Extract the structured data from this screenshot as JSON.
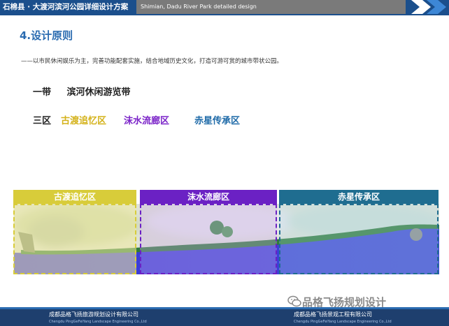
{
  "header": {
    "title_cn": "石棉县 · 大渡河滨河公园详细设计方案",
    "title_en": "Shimian, Dadu River Park detailed design"
  },
  "section": {
    "title": "4.设计原则",
    "intro": "——以市民休闲娱乐为主，完善功能配套实施，结合地域历史文化，打造可游可赏的城市带状公园。"
  },
  "belt": {
    "prefix": "一带",
    "name": "滨河休闲游览带"
  },
  "zones_row": {
    "prefix": "三区",
    "items": [
      {
        "name": "古渡追忆区",
        "color": "#d4b21a"
      },
      {
        "name": "沫水流廊区",
        "color": "#7a22c8"
      },
      {
        "name": "赤星传承区",
        "color": "#1e6aa8"
      }
    ]
  },
  "map_zones": [
    {
      "label": "古渡追忆区",
      "color": "#d8cc3a"
    },
    {
      "label": "沫水流廊区",
      "color": "#6b21c4"
    },
    {
      "label": "赤星传承区",
      "color": "#1f6d90"
    }
  ],
  "footer": {
    "left_cn": "成都品格飞扬旅游规划设计有限公司",
    "left_en": "Chengdu PingGeFeiYang Landscape Engineering Co.,Ltd",
    "right_cn": "成都品格飞扬景观工程有限公司",
    "right_en": "Chengdu PingGeFeiYang Landscape Engineering Co.,Ltd"
  },
  "watermark": "品格飞扬规划设计",
  "icons": [
    "wechat-icon",
    "header-arrow-icon"
  ]
}
